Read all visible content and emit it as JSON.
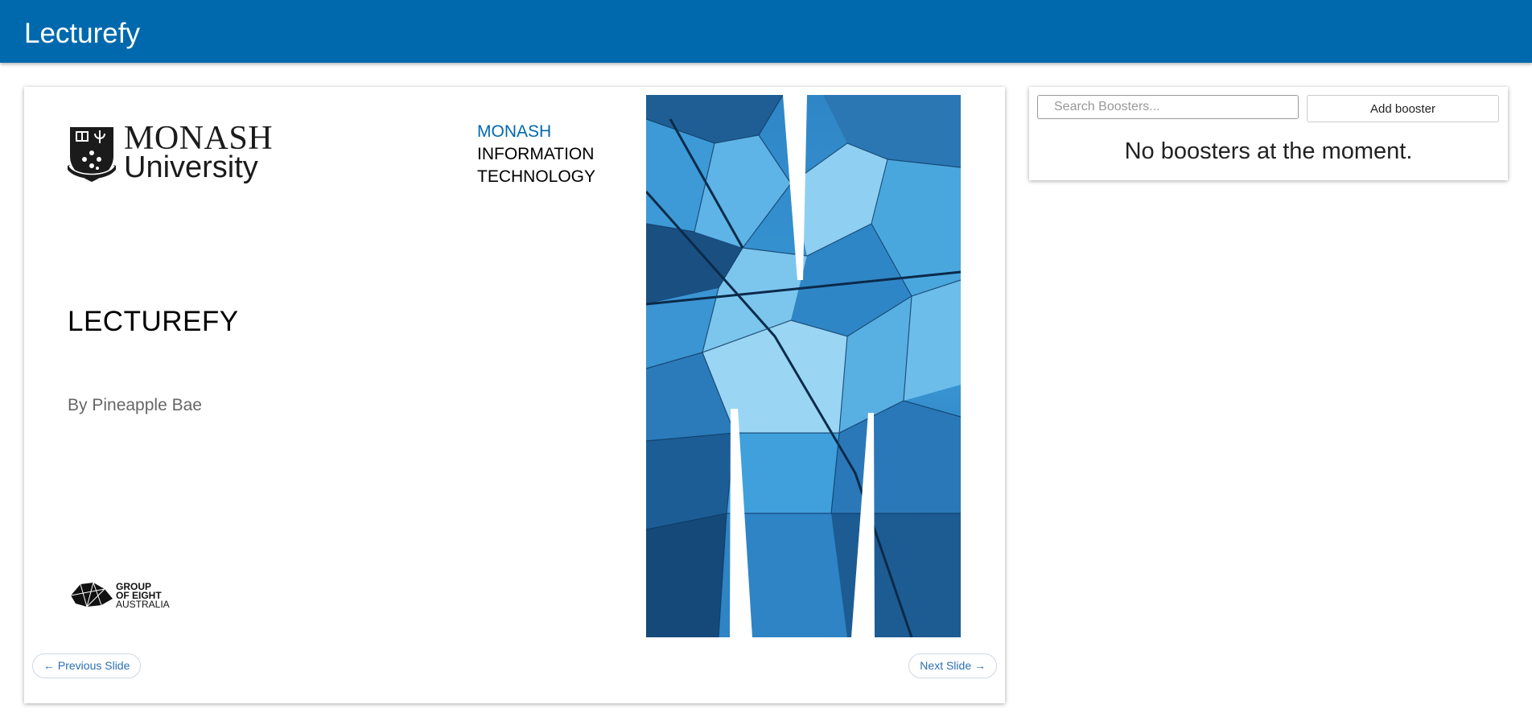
{
  "app": {
    "title": "Lecturefy"
  },
  "slide": {
    "logo": {
      "line1": "MONASH",
      "line2": "University"
    },
    "faculty": {
      "line1": "MONASH",
      "line2": "INFORMATION",
      "line3": "TECHNOLOGY"
    },
    "title": "LECTUREFY",
    "subtitle": "By Pineapple Bae",
    "partner_logo": {
      "line1": "GROUP",
      "line2": "OF EIGHT",
      "line3": "AUSTRALIA"
    }
  },
  "navigation": {
    "prev_label": "← Previous Slide",
    "next_label": "Next Slide →"
  },
  "boosters": {
    "search_placeholder": "Search Boosters...",
    "search_value": "",
    "add_label": "Add booster",
    "empty_message": "No boosters at the moment."
  },
  "colors": {
    "header_bg": "#0069ae",
    "accent_blue": "#0069ae",
    "link_blue": "#2a6fb0"
  }
}
